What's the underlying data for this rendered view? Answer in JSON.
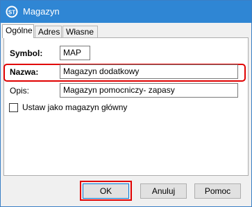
{
  "window": {
    "title": "Magazyn",
    "titlebar_color": "#2f86d4",
    "icon": "app-logo-icon"
  },
  "tabs": [
    {
      "label": "Ogólne",
      "active": true
    },
    {
      "label": "Adres",
      "active": false
    },
    {
      "label": "Własne",
      "active": false
    }
  ],
  "form": {
    "symbol_label": "Symbol:",
    "symbol_value": "MAP",
    "name_label": "Nazwa:",
    "name_value": "Magazyn dodatkowy",
    "description_label": "Opis:",
    "description_value": "Magazyn pomocniczy- zapasy",
    "main_warehouse_checkbox_label": "Ustaw jako magazyn główny",
    "main_warehouse_checked": false
  },
  "buttons": {
    "ok": "OK",
    "cancel": "Anuluj",
    "help": "Pomoc"
  },
  "highlight_color": "#e00000"
}
